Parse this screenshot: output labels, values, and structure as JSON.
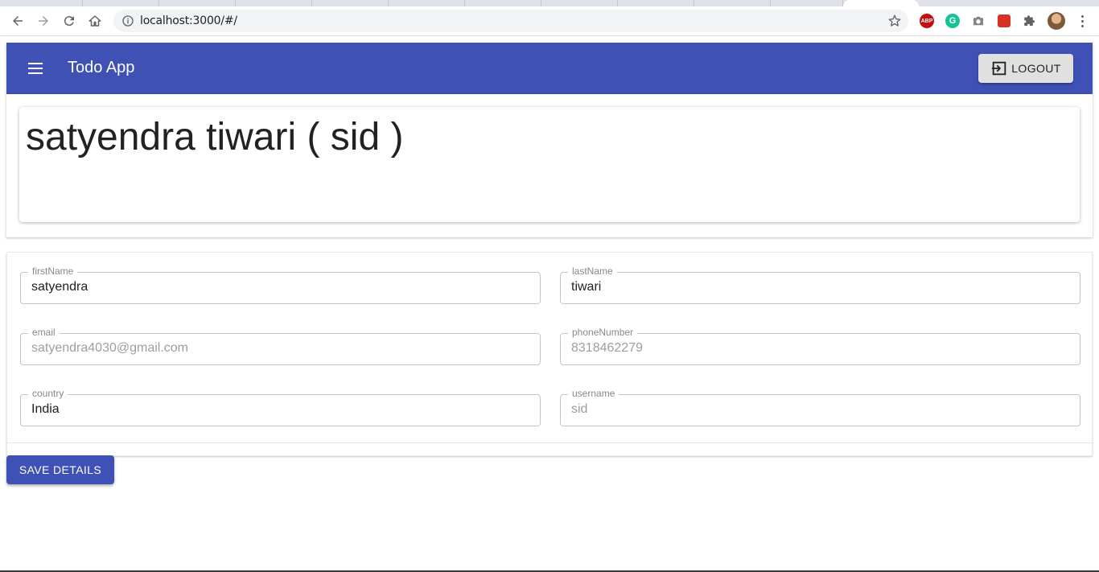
{
  "browser": {
    "url": "localhost:3000/#/",
    "extensions": [
      "ABP",
      "G"
    ]
  },
  "app": {
    "title": "Todo App",
    "logout_label": "LOGOUT",
    "accent_color": "#3f51b5"
  },
  "profile": {
    "display_name": "satyendra tiwari ( sid )"
  },
  "form": {
    "fields": [
      {
        "label": "firstName",
        "value": "satyendra",
        "disabled": false
      },
      {
        "label": "lastName",
        "value": "tiwari",
        "disabled": false
      },
      {
        "label": "email",
        "value": "satyendra4030@gmail.com",
        "disabled": true
      },
      {
        "label": "phoneNumber",
        "value": "8318462279",
        "disabled": true
      },
      {
        "label": "country",
        "value": "India",
        "disabled": false
      },
      {
        "label": "username",
        "value": "sid",
        "disabled": true
      }
    ]
  },
  "save_label": "SAVE DETAILS"
}
